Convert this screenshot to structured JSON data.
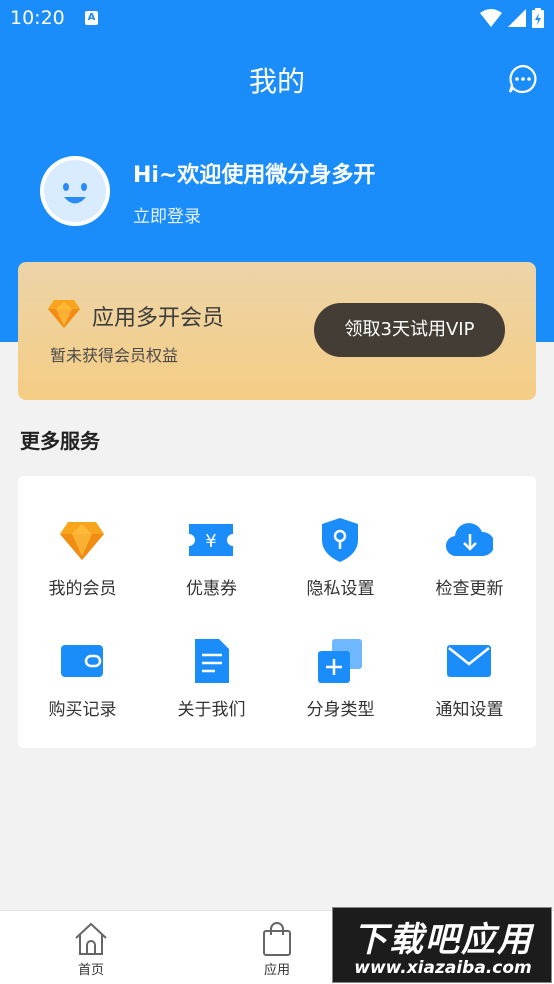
{
  "status_bar": {
    "time": "10:20",
    "notification_letter": "A"
  },
  "header": {
    "title": "我的"
  },
  "profile": {
    "welcome": "Hi~欢迎使用微分身多开",
    "login": "立即登录"
  },
  "vip_card": {
    "title": "应用多开会员",
    "subtitle": "暂未获得会员权益",
    "button": "领取3天试用VIP"
  },
  "services": {
    "title": "更多服务",
    "items": [
      {
        "label": "我的会员",
        "icon": "diamond-icon"
      },
      {
        "label": "优惠券",
        "icon": "coupon-icon"
      },
      {
        "label": "隐私设置",
        "icon": "shield-icon"
      },
      {
        "label": "检查更新",
        "icon": "cloud-download-icon"
      },
      {
        "label": "购买记录",
        "icon": "wallet-icon"
      },
      {
        "label": "关于我们",
        "icon": "document-icon"
      },
      {
        "label": "分身类型",
        "icon": "add-copy-icon"
      },
      {
        "label": "通知设置",
        "icon": "mail-icon"
      }
    ]
  },
  "tabbar": {
    "items": [
      {
        "label": "首页",
        "icon": "home-icon"
      },
      {
        "label": "应用",
        "icon": "bag-icon"
      }
    ]
  },
  "watermark": {
    "line1": "下载吧应用",
    "line2": "www.xiazaiba.com"
  },
  "colors": {
    "primary": "#1b8dfa",
    "vip_gold": "#f5cd84",
    "vip_button": "#433d35"
  }
}
